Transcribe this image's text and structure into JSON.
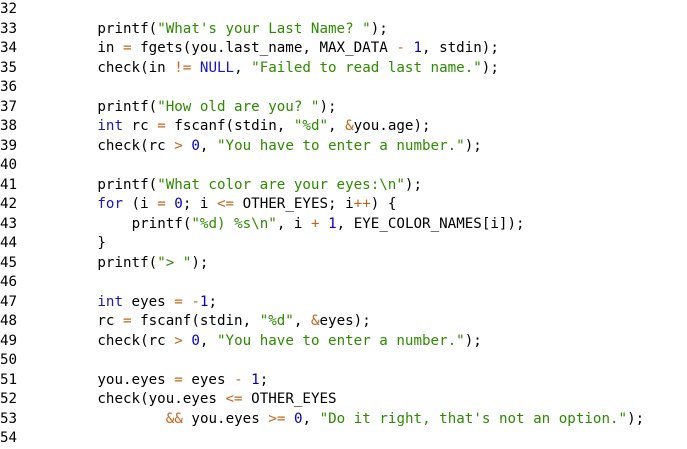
{
  "editor": {
    "colors": {
      "background": "#ffffff",
      "string": "#2e8b00",
      "number": "#0000cc",
      "keyword": "#1616c8",
      "operator": "#c8641a",
      "plain": "#000000"
    },
    "lines": [
      {
        "num": "32",
        "indent": 0,
        "tokens": []
      },
      {
        "num": "33",
        "indent": 8,
        "tokens": [
          [
            "plain",
            "printf("
          ],
          [
            "str",
            "\"What's your Last Name? \""
          ],
          [
            "plain",
            ");"
          ]
        ]
      },
      {
        "num": "34",
        "indent": 8,
        "tokens": [
          [
            "plain",
            "in "
          ],
          [
            "op",
            "="
          ],
          [
            "plain",
            " fgets(you.last_name, MAX_DATA "
          ],
          [
            "op",
            "-"
          ],
          [
            "plain",
            " "
          ],
          [
            "num",
            "1"
          ],
          [
            "plain",
            ", stdin);"
          ]
        ]
      },
      {
        "num": "35",
        "indent": 8,
        "tokens": [
          [
            "plain",
            "check(in "
          ],
          [
            "op",
            "!="
          ],
          [
            "plain",
            " "
          ],
          [
            "kw",
            "NULL"
          ],
          [
            "plain",
            ", "
          ],
          [
            "str",
            "\"Failed to read last name.\""
          ],
          [
            "plain",
            ");"
          ]
        ]
      },
      {
        "num": "36",
        "indent": 0,
        "tokens": []
      },
      {
        "num": "37",
        "indent": 8,
        "tokens": [
          [
            "plain",
            "printf("
          ],
          [
            "str",
            "\"How old are you? \""
          ],
          [
            "plain",
            ");"
          ]
        ]
      },
      {
        "num": "38",
        "indent": 8,
        "tokens": [
          [
            "kw",
            "int"
          ],
          [
            "plain",
            " rc "
          ],
          [
            "op",
            "="
          ],
          [
            "plain",
            " fscanf(stdin, "
          ],
          [
            "str",
            "\"%d\""
          ],
          [
            "plain",
            ", "
          ],
          [
            "op",
            "&"
          ],
          [
            "plain",
            "you.age);"
          ]
        ]
      },
      {
        "num": "39",
        "indent": 8,
        "tokens": [
          [
            "plain",
            "check(rc "
          ],
          [
            "op",
            ">"
          ],
          [
            "plain",
            " "
          ],
          [
            "num",
            "0"
          ],
          [
            "plain",
            ", "
          ],
          [
            "str",
            "\"You have to enter a number.\""
          ],
          [
            "plain",
            ");"
          ]
        ]
      },
      {
        "num": "40",
        "indent": 0,
        "tokens": []
      },
      {
        "num": "41",
        "indent": 8,
        "tokens": [
          [
            "plain",
            "printf("
          ],
          [
            "str",
            "\"What color are your eyes:\\n\""
          ],
          [
            "plain",
            ");"
          ]
        ]
      },
      {
        "num": "42",
        "indent": 8,
        "tokens": [
          [
            "kw",
            "for"
          ],
          [
            "plain",
            " (i "
          ],
          [
            "op",
            "="
          ],
          [
            "plain",
            " "
          ],
          [
            "num",
            "0"
          ],
          [
            "plain",
            "; i "
          ],
          [
            "op",
            "<="
          ],
          [
            "plain",
            " OTHER_EYES; i"
          ],
          [
            "op",
            "++"
          ],
          [
            "plain",
            ") {"
          ]
        ]
      },
      {
        "num": "43",
        "indent": 12,
        "tokens": [
          [
            "plain",
            "printf("
          ],
          [
            "str",
            "\"%d) %s\\n\""
          ],
          [
            "plain",
            ", i "
          ],
          [
            "op",
            "+"
          ],
          [
            "plain",
            " "
          ],
          [
            "num",
            "1"
          ],
          [
            "plain",
            ", EYE_COLOR_NAMES[i]);"
          ]
        ]
      },
      {
        "num": "44",
        "indent": 8,
        "tokens": [
          [
            "plain",
            "}"
          ]
        ]
      },
      {
        "num": "45",
        "indent": 8,
        "tokens": [
          [
            "plain",
            "printf("
          ],
          [
            "str",
            "\"> \""
          ],
          [
            "plain",
            ");"
          ]
        ]
      },
      {
        "num": "46",
        "indent": 0,
        "tokens": []
      },
      {
        "num": "47",
        "indent": 8,
        "tokens": [
          [
            "kw",
            "int"
          ],
          [
            "plain",
            " eyes "
          ],
          [
            "op",
            "="
          ],
          [
            "plain",
            " "
          ],
          [
            "op",
            "-"
          ],
          [
            "num",
            "1"
          ],
          [
            "plain",
            ";"
          ]
        ]
      },
      {
        "num": "48",
        "indent": 8,
        "tokens": [
          [
            "plain",
            "rc "
          ],
          [
            "op",
            "="
          ],
          [
            "plain",
            " fscanf(stdin, "
          ],
          [
            "str",
            "\"%d\""
          ],
          [
            "plain",
            ", "
          ],
          [
            "op",
            "&"
          ],
          [
            "plain",
            "eyes);"
          ]
        ]
      },
      {
        "num": "49",
        "indent": 8,
        "tokens": [
          [
            "plain",
            "check(rc "
          ],
          [
            "op",
            ">"
          ],
          [
            "plain",
            " "
          ],
          [
            "num",
            "0"
          ],
          [
            "plain",
            ", "
          ],
          [
            "str",
            "\"You have to enter a number.\""
          ],
          [
            "plain",
            ");"
          ]
        ]
      },
      {
        "num": "50",
        "indent": 0,
        "tokens": []
      },
      {
        "num": "51",
        "indent": 8,
        "tokens": [
          [
            "plain",
            "you.eyes "
          ],
          [
            "op",
            "="
          ],
          [
            "plain",
            " eyes "
          ],
          [
            "op",
            "-"
          ],
          [
            "plain",
            " "
          ],
          [
            "num",
            "1"
          ],
          [
            "plain",
            ";"
          ]
        ]
      },
      {
        "num": "52",
        "indent": 8,
        "tokens": [
          [
            "plain",
            "check(you.eyes "
          ],
          [
            "op",
            "<="
          ],
          [
            "plain",
            " OTHER_EYES"
          ]
        ]
      },
      {
        "num": "53",
        "indent": 16,
        "tokens": [
          [
            "op",
            "&&"
          ],
          [
            "plain",
            " you.eyes "
          ],
          [
            "op",
            ">="
          ],
          [
            "plain",
            " "
          ],
          [
            "num",
            "0"
          ],
          [
            "plain",
            ", "
          ],
          [
            "str",
            "\"Do it right, that's not an option.\""
          ],
          [
            "plain",
            ");"
          ]
        ]
      },
      {
        "num": "54",
        "indent": 0,
        "tokens": []
      }
    ]
  }
}
